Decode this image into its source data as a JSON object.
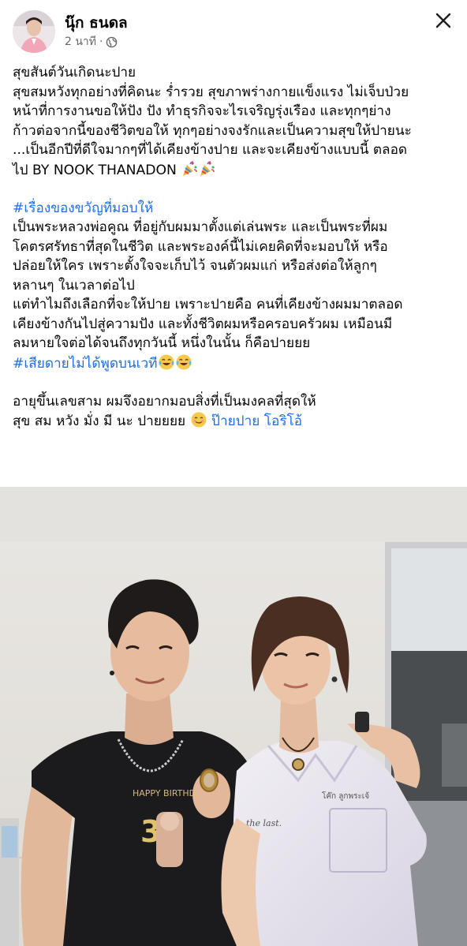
{
  "post": {
    "author": "นุ๊ก ธนดล",
    "time": "2 นาที",
    "privacy_dot": "·",
    "lines": {
      "l1": "สุขสันต์วันเกิดนะปาย",
      "l2": "สุขสมหวังทุกอย่างที่คิดนะ ร่ำรวย สุขภาพร่างกายแข็งแรง ไม่เจ็บป่วย",
      "l3": "หน้าที่การงานขอให้ปัง ปัง ทำธุรกิจจะไรเจริญรุ่งเรือง และทุกๆย่าง",
      "l4": "ก้าวต่อจากนี้ของชีวิตขอให้ ทุกๆอย่างจงรักและเป็นความสุขให้ปายนะ",
      "l5": "...เป็นอีกปีที่ดีใจมากๆที่ได้เคียงข้างปาย และจะเคียงข้างแบบนี้ ตลอด",
      "l6": "ไป BY NOOK THANADON",
      "hashtag1": "#เรื่องของขวัญที่มอบให้",
      "l8": "เป็นพระหลวงพ่อคูณ ที่อยู่กับผมมาตั้งแต่เล่นพระ และเป็นพระที่ผม",
      "l9": "โคตรศรัทธาที่สุดในชีวิต และพระองค์นี้ไม่เคยคิดที่จะมอบให้ หรือ",
      "l10": "ปล่อยให้ใคร เพราะตั้งใจจะเก็บไว้ จนตัวผมแก่ หรือส่งต่อให้ลูกๆ",
      "l11": "หลานๆ ในเวลาต่อไป",
      "l12": "แต่ทำไมถึงเลือกที่จะให้ปาย เพราะปายคือ คนที่เคียงข้างผมมาตลอด",
      "l13": "เคียงข้างกันไปสู่ความปัง และทั้งชีวิตผมหรือครอบครัวผม เหมือนมี",
      "l14": "ลมหายใจต่อได้จนถึงทุกวันนี้ หนึ่งในนั้น ก็คือปายยย",
      "hashtag2": "#เสียดายไม่ได้พูดบนเวที",
      "l16": "อายุขึ้นเลขสาม ผมจึงอยากมอบสิ่งที่เป็นมงคลที่สุดให้",
      "l17": "สุข สม หวัง มั่ง มี นะ ปายยยย",
      "mention": "ป๊ายปาย โอริโอ้"
    },
    "photo": {
      "shirt_print": "HAPPY BIRTHDAY",
      "shirt_number": "30",
      "uniform_text": "the last.",
      "uniform_name": "โค๊ก ลูกพระเจ้"
    }
  },
  "icons": {
    "close": "close-icon",
    "globe": "globe-icon",
    "party": "party-popper-icon",
    "laugh": "tears-of-joy-icon",
    "smile": "smiling-face-icon"
  },
  "colors": {
    "link": "#216fdb",
    "meta": "#65676b",
    "text": "#050505"
  }
}
